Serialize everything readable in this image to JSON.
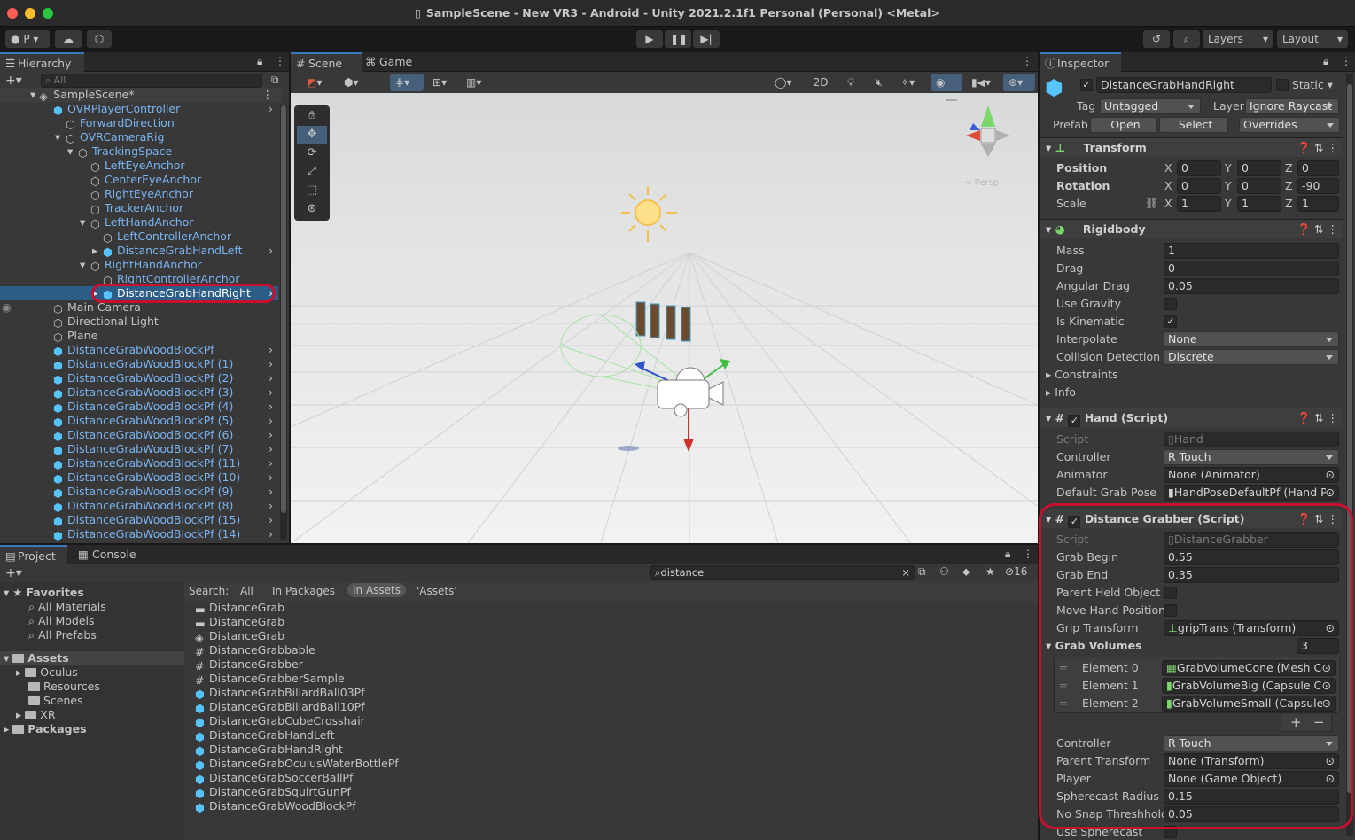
{
  "window": {
    "title": "SampleScene - New VR3 - Android - Unity 2021.2.1f1 Personal (Personal) <Metal>"
  },
  "toolbar": {
    "account": "P",
    "layers": "Layers",
    "layout": "Layout"
  },
  "hierarchy": {
    "tab": "Hierarchy",
    "search_placeholder": "All",
    "scene": "SampleScene*",
    "items": [
      {
        "label": "OVRPlayerController",
        "depth": 1,
        "cube": true,
        "arrow": ">"
      },
      {
        "label": "ForwardDirection",
        "depth": 2
      },
      {
        "label": "OVRCameraRig",
        "depth": 2
      },
      {
        "label": "TrackingSpace",
        "depth": 3
      },
      {
        "label": "LeftEyeAnchor",
        "depth": 4
      },
      {
        "label": "CenterEyeAnchor",
        "depth": 4
      },
      {
        "label": "RightEyeAnchor",
        "depth": 4
      },
      {
        "label": "TrackerAnchor",
        "depth": 4
      },
      {
        "label": "LeftHandAnchor",
        "depth": 4
      },
      {
        "label": "LeftControllerAnchor",
        "depth": 5
      },
      {
        "label": "DistanceGrabHandLeft",
        "depth": 5,
        "cube": true,
        "arrow": ">"
      },
      {
        "label": "RightHandAnchor",
        "depth": 4
      },
      {
        "label": "RightControllerAnchor",
        "depth": 5
      },
      {
        "label": "DistanceGrabHandRight",
        "depth": 5,
        "cube": true,
        "arrow": ">",
        "selected": true
      },
      {
        "label": "Main Camera",
        "depth": 1
      },
      {
        "label": "Directional Light",
        "depth": 1
      },
      {
        "label": "Plane",
        "depth": 1
      },
      {
        "label": "DistanceGrabWoodBlockPf",
        "depth": 1,
        "cube": true,
        "arrow": ">"
      },
      {
        "label": "DistanceGrabWoodBlockPf (1)",
        "depth": 1,
        "cube": true,
        "arrow": ">"
      },
      {
        "label": "DistanceGrabWoodBlockPf (2)",
        "depth": 1,
        "cube": true,
        "arrow": ">"
      },
      {
        "label": "DistanceGrabWoodBlockPf (3)",
        "depth": 1,
        "cube": true,
        "arrow": ">"
      },
      {
        "label": "DistanceGrabWoodBlockPf (4)",
        "depth": 1,
        "cube": true,
        "arrow": ">"
      },
      {
        "label": "DistanceGrabWoodBlockPf (5)",
        "depth": 1,
        "cube": true,
        "arrow": ">"
      },
      {
        "label": "DistanceGrabWoodBlockPf (6)",
        "depth": 1,
        "cube": true,
        "arrow": ">"
      },
      {
        "label": "DistanceGrabWoodBlockPf (7)",
        "depth": 1,
        "cube": true,
        "arrow": ">"
      },
      {
        "label": "DistanceGrabWoodBlockPf (11)",
        "depth": 1,
        "cube": true,
        "arrow": ">"
      },
      {
        "label": "DistanceGrabWoodBlockPf (10)",
        "depth": 1,
        "cube": true,
        "arrow": ">"
      },
      {
        "label": "DistanceGrabWoodBlockPf (9)",
        "depth": 1,
        "cube": true,
        "arrow": ">"
      },
      {
        "label": "DistanceGrabWoodBlockPf (8)",
        "depth": 1,
        "cube": true,
        "arrow": ">"
      },
      {
        "label": "DistanceGrabWoodBlockPf (15)",
        "depth": 1,
        "cube": true,
        "arrow": ">"
      },
      {
        "label": "DistanceGrabWoodBlockPf (14)",
        "depth": 1,
        "cube": true,
        "arrow": ">"
      }
    ]
  },
  "scene_view": {
    "tab_scene": "Scene",
    "tab_game": "Game",
    "btn_2d": "2D",
    "persp": "< Persp"
  },
  "project": {
    "tab_project": "Project",
    "tab_console": "Console",
    "search_value": "distance",
    "hidden_count": "16",
    "favorites_label": "Favorites",
    "favorites": [
      "All Materials",
      "All Models",
      "All Prefabs"
    ],
    "assets_label": "Assets",
    "assets": [
      "Oculus",
      "Resources",
      "Scenes",
      "XR"
    ],
    "packages_label": "Packages",
    "search_label": "Search:",
    "search_scopes": [
      "All",
      "In Packages",
      "In Assets",
      "'Assets'"
    ],
    "results": [
      {
        "label": "DistanceGrab",
        "kind": "folder"
      },
      {
        "label": "DistanceGrab",
        "kind": "folder"
      },
      {
        "label": "DistanceGrab",
        "kind": "scene"
      },
      {
        "label": "DistanceGrabbable",
        "kind": "script"
      },
      {
        "label": "DistanceGrabber",
        "kind": "script"
      },
      {
        "label": "DistanceGrabberSample",
        "kind": "script"
      },
      {
        "label": "DistanceGrabBillardBall03Pf",
        "kind": "prefab"
      },
      {
        "label": "DistanceGrabBillardBall10Pf",
        "kind": "prefab"
      },
      {
        "label": "DistanceGrabCubeCrosshair",
        "kind": "prefab"
      },
      {
        "label": "DistanceGrabHandLeft",
        "kind": "prefab"
      },
      {
        "label": "DistanceGrabHandRight",
        "kind": "prefab"
      },
      {
        "label": "DistanceGrabOculusWaterBottlePf",
        "kind": "prefab"
      },
      {
        "label": "DistanceGrabSoccerBallPf",
        "kind": "prefab"
      },
      {
        "label": "DistanceGrabSquirtGunPf",
        "kind": "prefab"
      },
      {
        "label": "DistanceGrabWoodBlockPf",
        "kind": "prefab"
      }
    ]
  },
  "inspector": {
    "tab": "Inspector",
    "object_name": "DistanceGrabHandRight",
    "static_label": "Static",
    "tag_label": "Tag",
    "tag_value": "Untagged",
    "layer_label": "Layer",
    "layer_value": "Ignore Raycast",
    "prefab_label": "Prefab",
    "prefab_open": "Open",
    "prefab_select": "Select",
    "prefab_overrides": "Overrides",
    "transform": {
      "title": "Transform",
      "position_label": "Position",
      "position": [
        "0",
        "0",
        "0"
      ],
      "rotation_label": "Rotation",
      "rotation": [
        "0",
        "0",
        "-90"
      ],
      "scale_label": "Scale",
      "scale": [
        "1",
        "1",
        "1"
      ]
    },
    "rigidbody": {
      "title": "Rigidbody",
      "mass_label": "Mass",
      "mass": "1",
      "drag_label": "Drag",
      "drag": "0",
      "angular_drag_label": "Angular Drag",
      "angular_drag": "0.05",
      "use_gravity_label": "Use Gravity",
      "is_kinematic_label": "Is Kinematic",
      "interpolate_label": "Interpolate",
      "interpolate": "None",
      "collision_label": "Collision Detection",
      "collision": "Discrete",
      "constraints_label": "Constraints",
      "info_label": "Info"
    },
    "hand": {
      "title": "Hand (Script)",
      "script_label": "Script",
      "script": "Hand",
      "controller_label": "Controller",
      "controller": "R Touch",
      "animator_label": "Animator",
      "animator": "None (Animator)",
      "grab_pose_label": "Default Grab Pose",
      "grab_pose": "HandPoseDefaultPf (Hand Pc"
    },
    "grabber": {
      "title": "Distance Grabber (Script)",
      "script_label": "Script",
      "script": "DistanceGrabber",
      "grab_begin_label": "Grab Begin",
      "grab_begin": "0.55",
      "grab_end_label": "Grab End",
      "grab_end": "0.35",
      "parent_held_label": "Parent Held Object",
      "move_hand_label": "Move Hand Position",
      "grip_label": "Grip Transform",
      "grip": "gripTrans (Transform)",
      "volumes_label": "Grab Volumes",
      "volumes_count": "3",
      "elements": [
        {
          "label": "Element 0",
          "value": "GrabVolumeCone (Mesh Col"
        },
        {
          "label": "Element 1",
          "value": "GrabVolumeBig (Capsule Co"
        },
        {
          "label": "Element 2",
          "value": "GrabVolumeSmall (Capsule ("
        }
      ],
      "add_btn": "+",
      "remove_btn": "−",
      "controller_label": "Controller",
      "controller": "R Touch",
      "parent_transform_label": "Parent Transform",
      "parent_transform": "None (Transform)",
      "player_label": "Player",
      "player": "None (Game Object)",
      "spherecast_label": "Spherecast Radius",
      "spherecast": "0.15",
      "nosnap_label": "No Snap Threshhold",
      "nosnap": "0.05",
      "use_spherecast_label": "Use Spherecast"
    }
  },
  "colors": {
    "highlight": "#c8102e",
    "selection": "#2c5d87",
    "cube_blue": "#56c3ff"
  }
}
